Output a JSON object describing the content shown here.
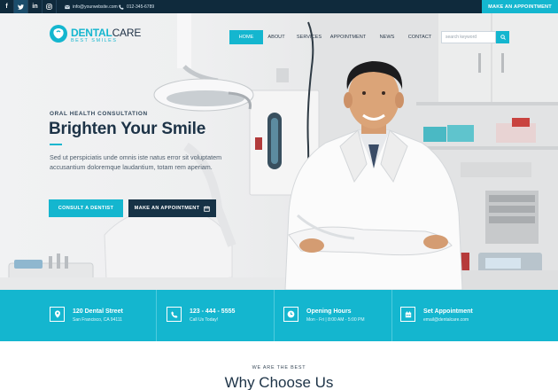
{
  "topbar": {
    "social": [
      "f",
      "twitter",
      "in",
      "instagram"
    ],
    "social_text": {
      "facebook": "f",
      "linkedin": "in"
    },
    "email": "info@yourwebsite.com",
    "phone": "012-345-6789",
    "cta": "MAKE AN APPOINTMENT"
  },
  "logo": {
    "brand_a": "DENTAL",
    "brand_b": "CARE",
    "tagline": "BEST SMILES"
  },
  "nav": [
    "HOME",
    "ABOUT",
    "SERVICES",
    "APPOINTMENT",
    "NEWS",
    "CONTACT"
  ],
  "nav_active": "HOME",
  "search": {
    "placeholder": "search keyword"
  },
  "hero": {
    "eyebrow": "ORAL HEALTH CONSULTATION",
    "headline": "Brighten Your Smile",
    "text": "Sed ut perspiciatis unde omnis iste natus error sit voluptatem accusantium doloremque laudantium, totam rem aperiam.",
    "btn_consult": "CONSULT A DENTIST",
    "btn_appointment": "MAKE AN APPOINTMENT"
  },
  "info": [
    {
      "title": "120 Dental Street",
      "sub": "San Francisco, CA 94111",
      "icon": "map-pin-icon"
    },
    {
      "title": "123 - 444 - 5555",
      "sub": "Call Us Today!",
      "icon": "phone-icon"
    },
    {
      "title": "Opening Hours",
      "sub": "Mon - Fri | 8:00 AM - 5:00 PM",
      "icon": "clock-icon"
    },
    {
      "title": "Set Appointment",
      "sub": "email@dentalcare.com",
      "icon": "calendar-icon"
    }
  ],
  "section": {
    "kicker": "WE ARE THE BEST",
    "title": "Why Choose Us"
  },
  "colors": {
    "accent": "#14b6cf",
    "dark": "#0f2a3c",
    "navy": "#163246",
    "heading": "#1d3347"
  }
}
